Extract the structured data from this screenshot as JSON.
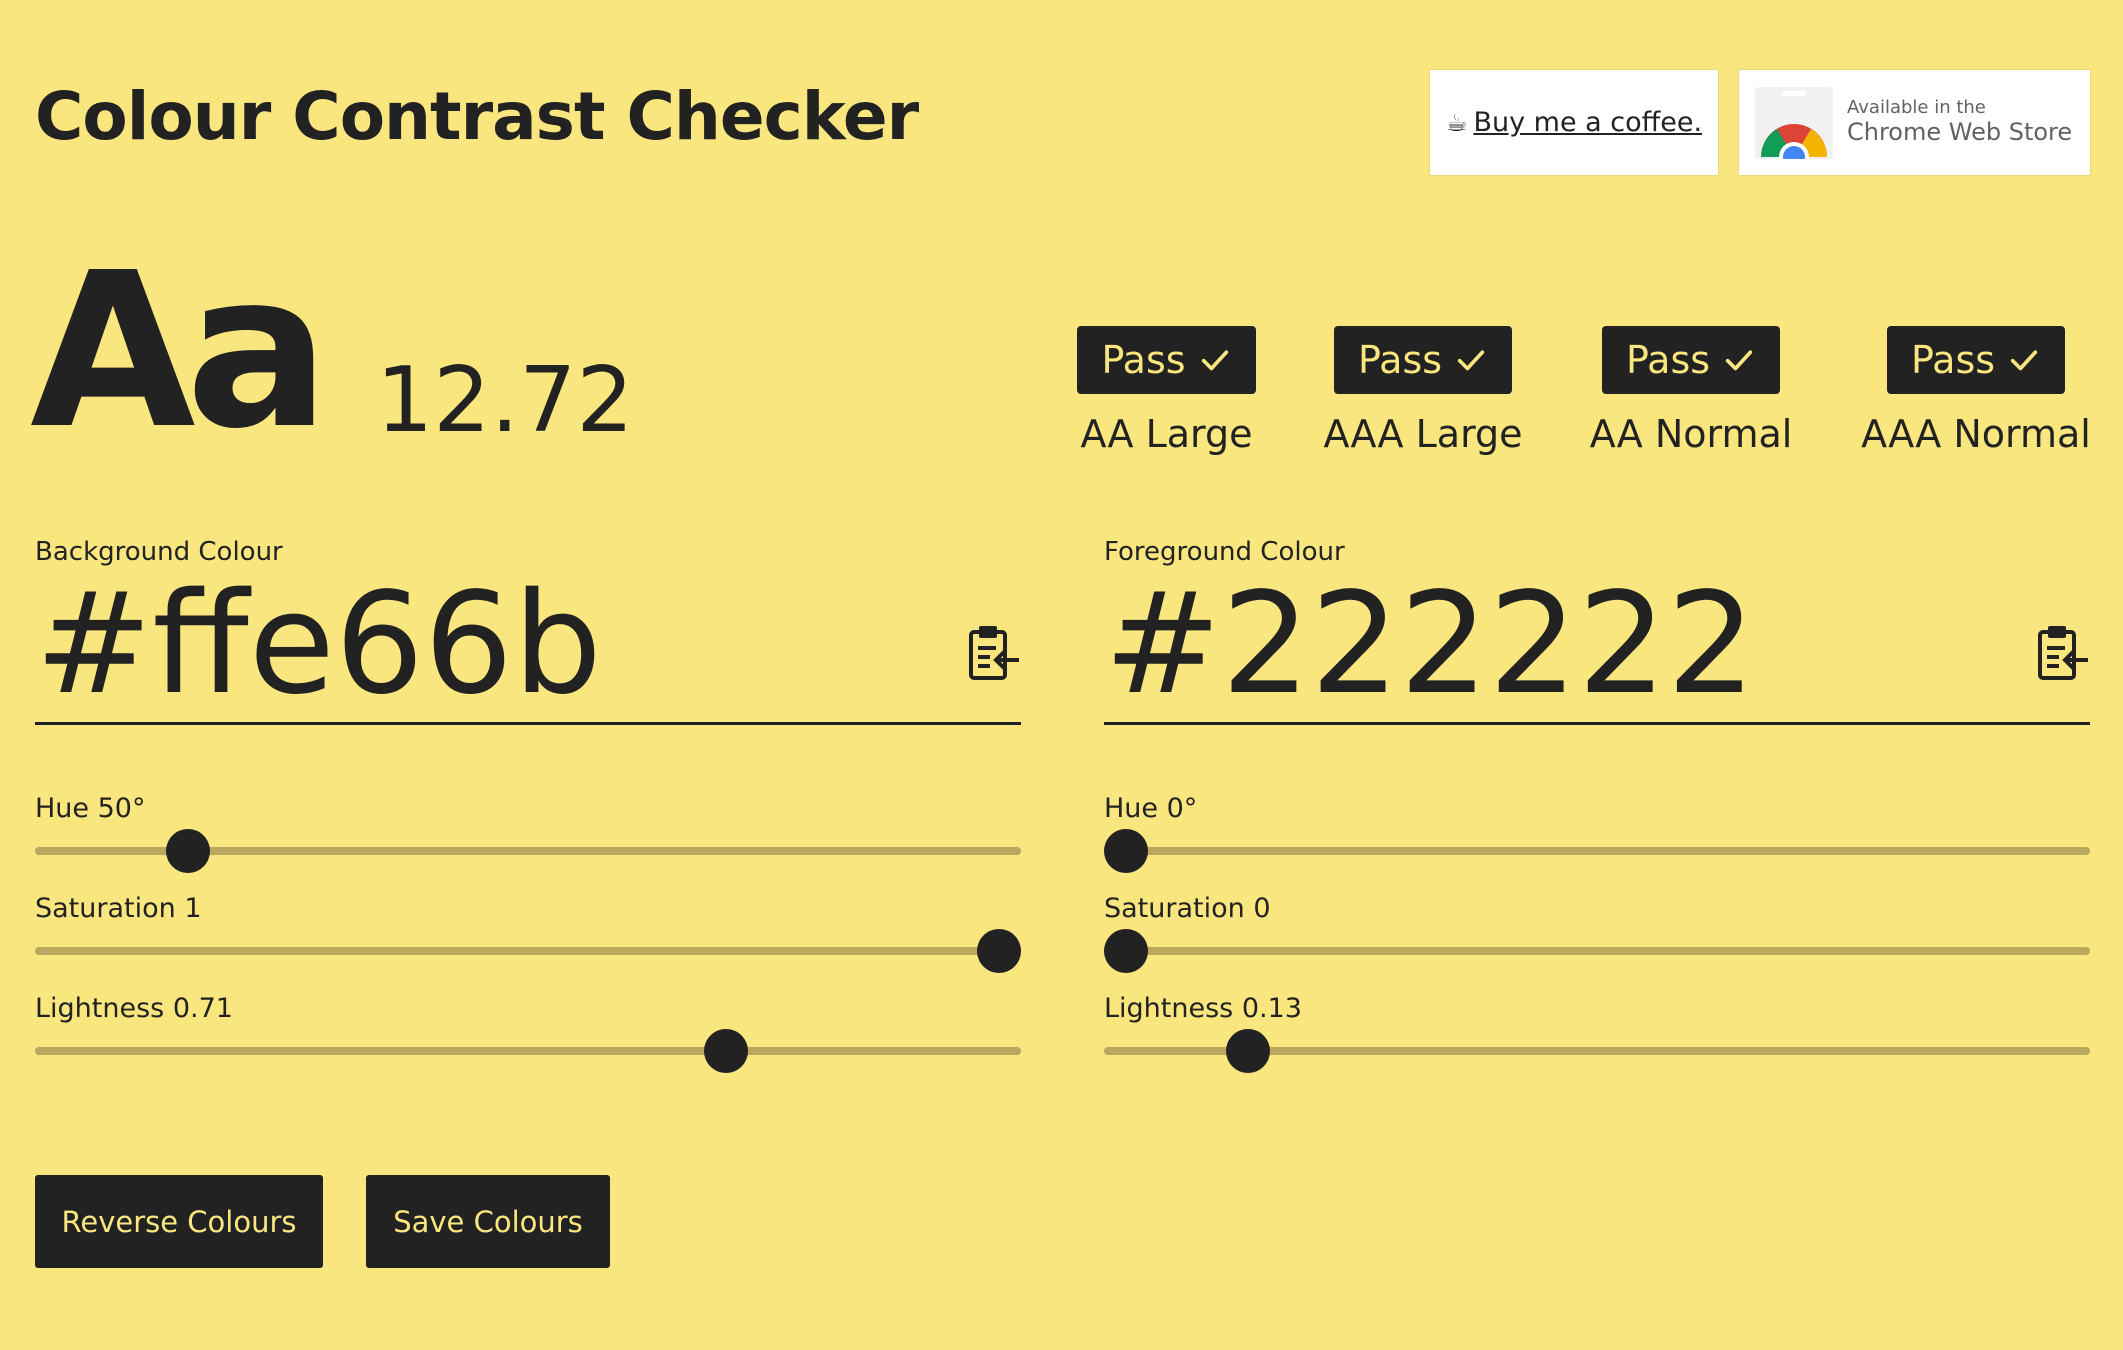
{
  "header": {
    "title": "Colour Contrast Checker",
    "coffee_emoji": "☕",
    "coffee_link": "Buy me a coffee.",
    "store_small": "Available in the",
    "store_big": "Chrome Web Store"
  },
  "preview": {
    "sample": "Aa",
    "ratio": "12.72"
  },
  "results": [
    {
      "status": "Pass",
      "label": "AA Large"
    },
    {
      "status": "Pass",
      "label": "AAA Large"
    },
    {
      "status": "Pass",
      "label": "AA Normal"
    },
    {
      "status": "Pass",
      "label": "AAA Normal"
    }
  ],
  "background": {
    "label": "Background Colour",
    "hex": "#ffe66b",
    "hue_label": "Hue 50°",
    "hue": 50,
    "saturation_label": "Saturation 1",
    "saturation": 1,
    "lightness_label": "Lightness 0.71",
    "lightness": 0.71
  },
  "foreground": {
    "label": "Foreground Colour",
    "hex": "#222222",
    "hue_label": "Hue 0°",
    "hue": 0,
    "saturation_label": "Saturation 0",
    "saturation": 0,
    "lightness_label": "Lightness 0.13",
    "lightness": 0.13
  },
  "buttons": {
    "reverse": "Reverse Colours",
    "save": "Save Colours"
  },
  "colors": {
    "page_background": "#fae67e",
    "foreground": "#222222",
    "track": "#b8a75c"
  }
}
